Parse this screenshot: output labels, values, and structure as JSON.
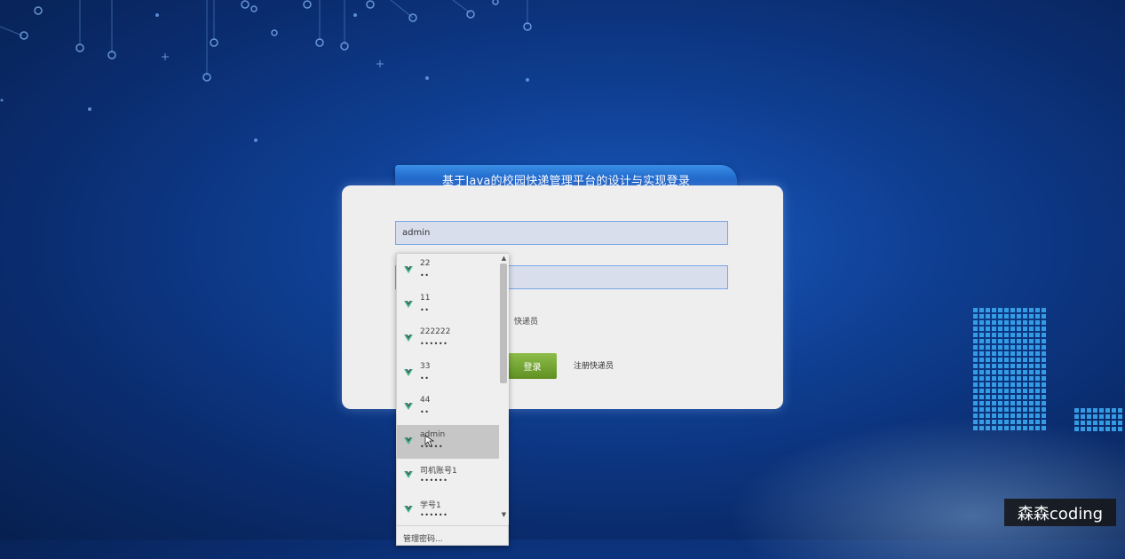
{
  "login": {
    "title": "基于Java的校园快递管理平台的设计与实现登录",
    "username_value": "admin",
    "password_value": "",
    "role_label": "快递员",
    "login_button": "登录",
    "register_link": "注册快递员"
  },
  "autocomplete": {
    "items": [
      {
        "user": "22",
        "pass": "••"
      },
      {
        "user": "11",
        "pass": "••"
      },
      {
        "user": "222222",
        "pass": "••••••"
      },
      {
        "user": "33",
        "pass": "••"
      },
      {
        "user": "44",
        "pass": "••"
      },
      {
        "user": "admin",
        "pass": "•••••"
      },
      {
        "user": "司机账号1",
        "pass": "••••••"
      },
      {
        "user": "学号1",
        "pass": "••••••"
      }
    ],
    "selected_index": 5,
    "footer": "管理密码..."
  },
  "watermark": "森森coding",
  "colors": {
    "accent": "#1b5fc4",
    "button_green": "#6b9a2a",
    "background": "#0f3f93"
  },
  "icons": {
    "credential": "vue-logo-icon",
    "scroll_up": "chevron-up-icon",
    "scroll_down": "chevron-down-icon"
  }
}
